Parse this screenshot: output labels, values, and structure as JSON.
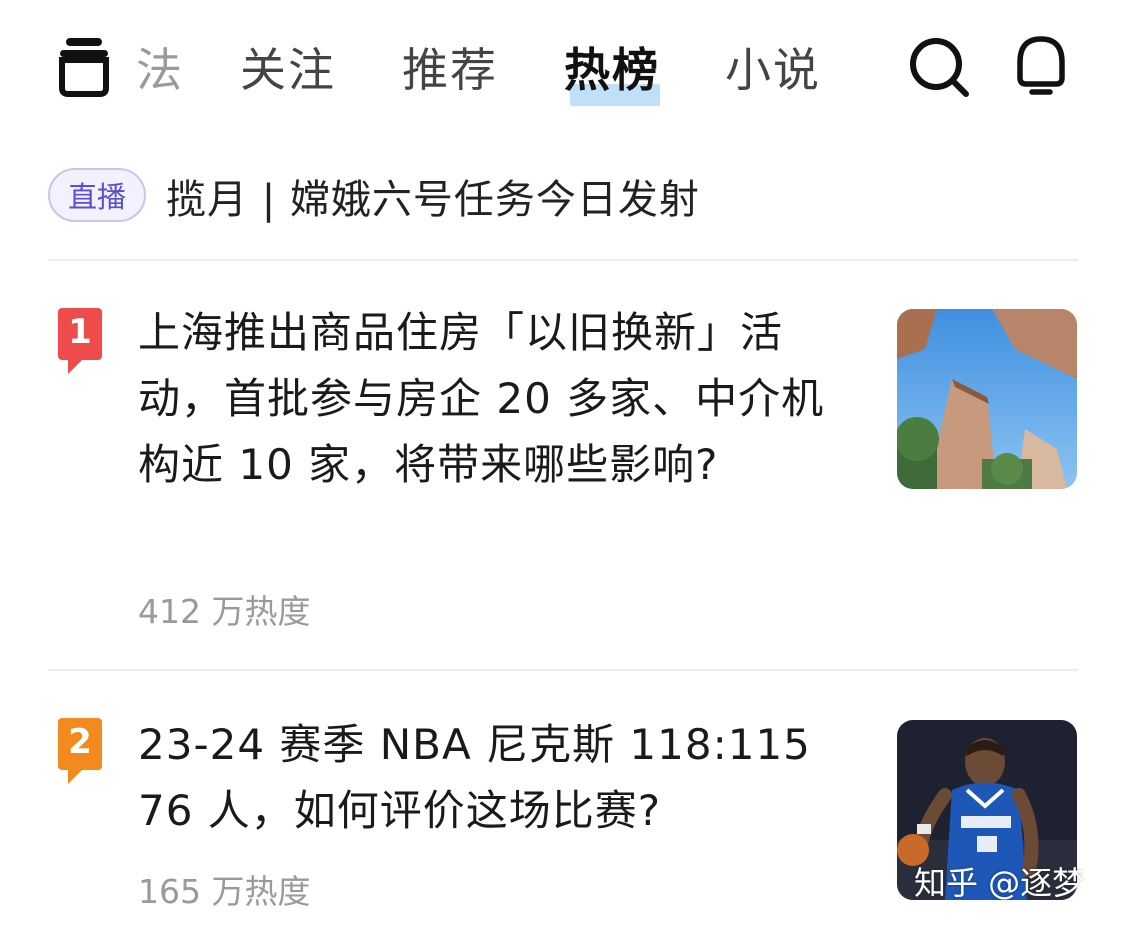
{
  "nav": {
    "tabs": [
      {
        "label": "法"
      },
      {
        "label": "关注"
      },
      {
        "label": "推荐"
      },
      {
        "label": "热榜"
      },
      {
        "label": "小说"
      }
    ],
    "active_tab": "热榜",
    "accent": "#bfe0f7"
  },
  "live": {
    "badge": "直播",
    "text": "揽月 | 嫦娥六号任务今日发射",
    "badge_color": "#5a4fcf"
  },
  "hot_list": [
    {
      "rank": "1",
      "title": "上海推出商品住房「以旧换新」活动，首批参与房企 20 多家、中介机构近 10 家，将带来哪些影响?",
      "heat": "412 万热度",
      "rank_color": "#ee4b4b"
    },
    {
      "rank": "2",
      "title": "23-24 赛季 NBA 尼克斯 118:115 76 人，如何评价这场比赛?",
      "heat": "165 万热度",
      "rank_color": "#f28a1d"
    }
  ],
  "watermark": "知乎 @逐梦"
}
